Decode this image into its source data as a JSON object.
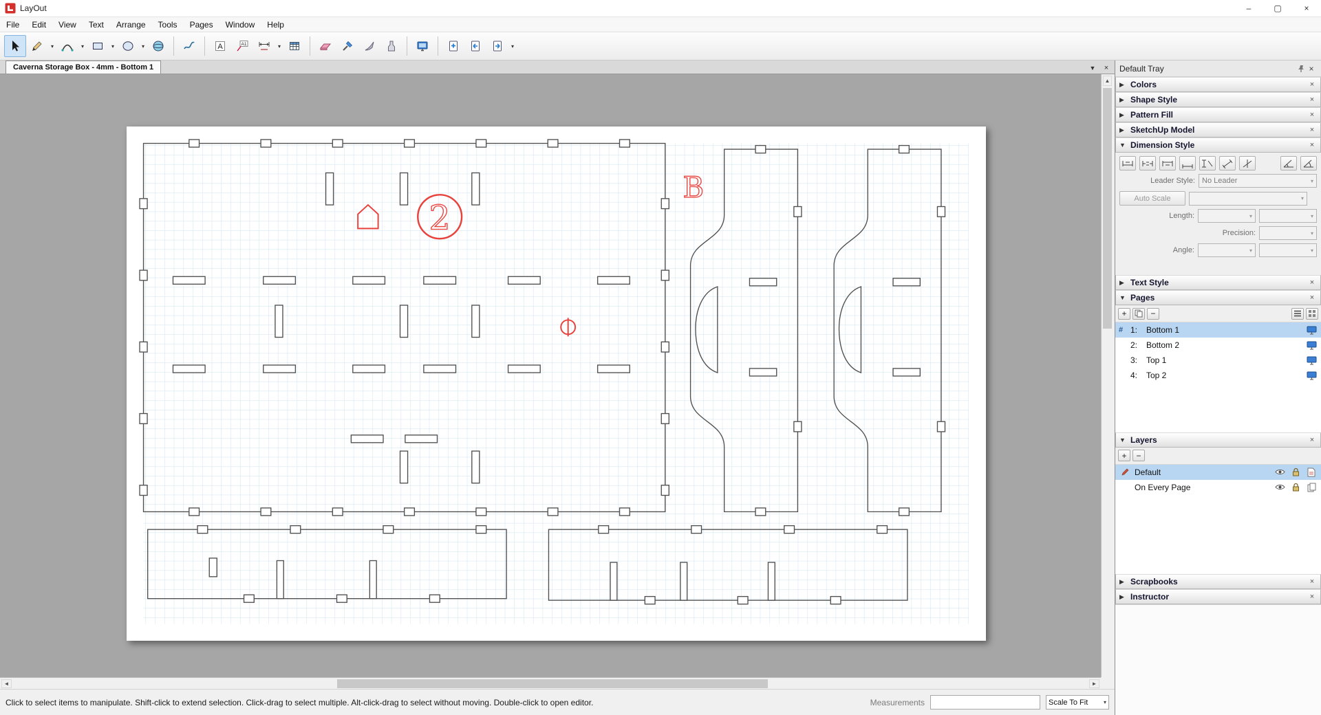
{
  "window": {
    "title": "LayOut",
    "minimize": "–",
    "maximize": "▢",
    "close": "×"
  },
  "menu": {
    "items": [
      "File",
      "Edit",
      "View",
      "Text",
      "Arrange",
      "Tools",
      "Pages",
      "Window",
      "Help"
    ]
  },
  "toolbar": {
    "tools": [
      "select",
      "lines",
      "arcs",
      "rectangles",
      "circles",
      "polygons",
      "freehand",
      "text",
      "labels",
      "dimensions",
      "tables",
      "eraser",
      "style",
      "split",
      "join",
      "start-presentation",
      "add-page",
      "previous-page",
      "next-page"
    ],
    "text_tool_glyph": "A",
    "label_tool_glyph": "A1"
  },
  "tabbar": {
    "active_tab": "Caverna Storage Box - 4mm - Bottom 1"
  },
  "drawing": {
    "mark_letter": "B",
    "mark_number": "2"
  },
  "tray": {
    "title": "Default Tray",
    "panels": {
      "colors": "Colors",
      "shape_style": "Shape Style",
      "pattern_fill": "Pattern Fill",
      "sketchup_model": "SketchUp Model",
      "dimension_style": "Dimension Style",
      "text_style": "Text Style",
      "pages": "Pages",
      "layers": "Layers",
      "scrapbooks": "Scrapbooks",
      "instructor": "Instructor"
    },
    "dimension_style": {
      "leader_style_label": "Leader Style:",
      "leader_style_value": "No Leader",
      "auto_scale_label": "Auto Scale",
      "length_label": "Length:",
      "precision_label": "Precision:",
      "angle_label": "Angle:"
    },
    "pages": {
      "rows": [
        {
          "num": "1:",
          "name": "Bottom 1"
        },
        {
          "num": "2:",
          "name": "Bottom 2"
        },
        {
          "num": "3:",
          "name": "Top 1"
        },
        {
          "num": "4:",
          "name": "Top 2"
        }
      ]
    },
    "layers": {
      "rows": [
        {
          "name": "Default"
        },
        {
          "name": "On Every Page"
        }
      ]
    }
  },
  "statusbar": {
    "hint": "Click to select items to manipulate. Shift-click to extend selection. Click-drag to select multiple. Alt-click-drag to select without moving. Double-click to open editor.",
    "measurements_label": "Measurements",
    "measurements_value": "",
    "scale_label": "Scale To Fit"
  },
  "icons": {
    "close": "×",
    "collapsed": "▶",
    "expanded": "▼",
    "plus": "+",
    "minus": "−",
    "dropdown": "▾",
    "hash": "#",
    "scroll_up": "▲",
    "scroll_down": "▼",
    "scroll_left": "◄",
    "scroll_right": "►"
  }
}
